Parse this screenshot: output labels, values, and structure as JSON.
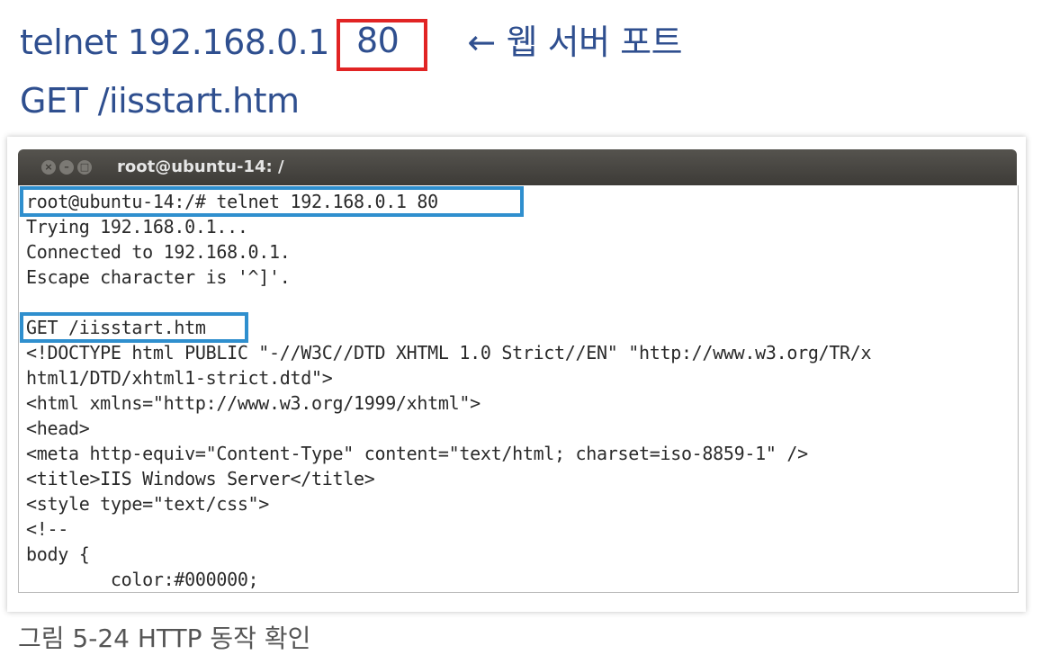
{
  "slide": {
    "line1_prefix": "telnet 192.168.0.1",
    "line1_port": "80",
    "line1_arrow": "←",
    "line1_note": "웹 서버 포트",
    "line2": "GET /iisstart.htm",
    "caption": "그림 5-24  HTTP 동작 확인"
  },
  "terminal": {
    "title": "root@ubuntu-14: /",
    "buttons": {
      "close": "×",
      "minimize": "–",
      "maximize": "□"
    },
    "lines": [
      "root@ubuntu-14:/# telnet 192.168.0.1 80",
      "Trying 192.168.0.1...",
      "Connected to 192.168.0.1.",
      "Escape character is '^]'.",
      "",
      "GET /iisstart.htm",
      "<!DOCTYPE html PUBLIC \"-//W3C//DTD XHTML 1.0 Strict//EN\" \"http://www.w3.org/TR/x",
      "html1/DTD/xhtml1-strict.dtd\">",
      "<html xmlns=\"http://www.w3.org/1999/xhtml\">",
      "<head>",
      "<meta http-equiv=\"Content-Type\" content=\"text/html; charset=iso-8859-1\" />",
      "<title>IIS Windows Server</title>",
      "<style type=\"text/css\">",
      "<!--",
      "body {",
      "        color:#000000;"
    ]
  },
  "colors": {
    "slide_text": "#2f4f8f",
    "port_highlight": "#e12424",
    "terminal_highlight": "#2f8fce",
    "titlebar": "#3d3b37"
  }
}
